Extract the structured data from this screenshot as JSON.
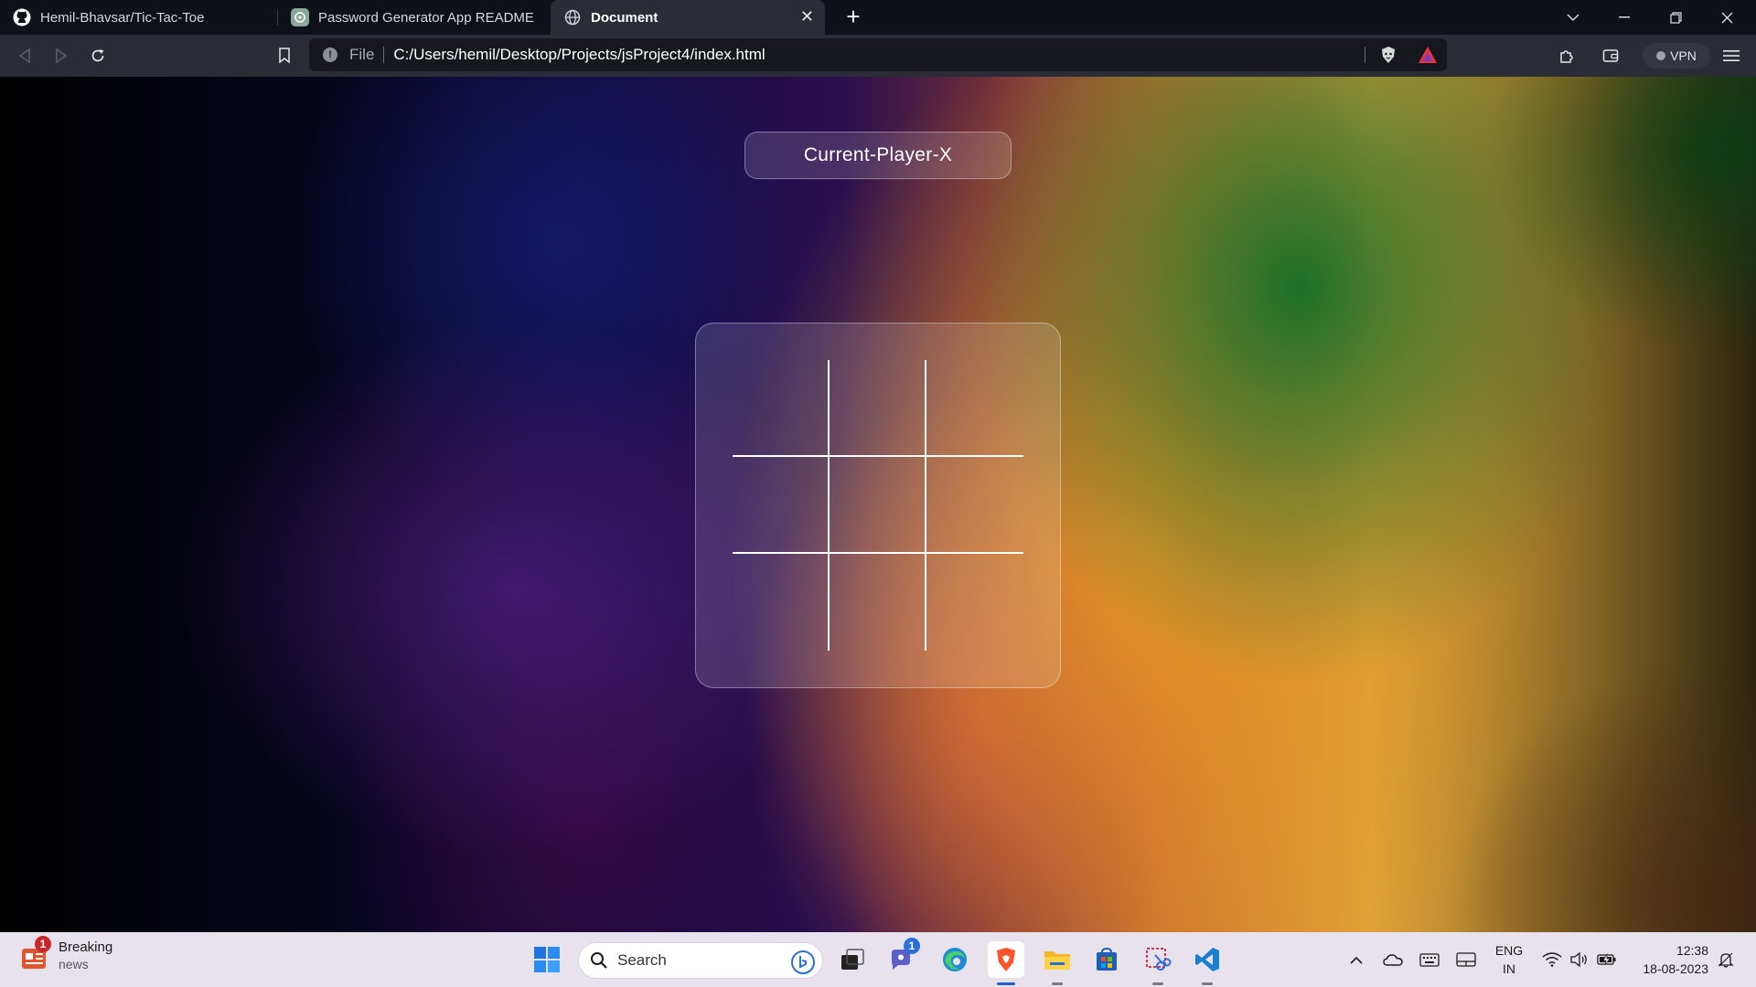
{
  "browser": {
    "tabs": [
      {
        "title": "Hemil-Bhavsar/Tic-Tac-Toe",
        "icon": "github-icon",
        "active": false
      },
      {
        "title": "Password Generator App README",
        "icon": "chatgpt-icon",
        "active": false
      },
      {
        "title": "Document",
        "icon": "globe-icon",
        "active": true
      }
    ],
    "new_tab": "+",
    "close_tab": "✕",
    "window_controls": {
      "dropdown": "⌵",
      "minimize": "—",
      "restore": "❐",
      "close": "✕"
    },
    "address": {
      "scheme_label": "File",
      "url": "C:/Users/hemil/Desktop/Projects/jsProject4/index.html"
    },
    "vpn_label": "VPN"
  },
  "page": {
    "current_player": "Current-Player-X",
    "board": [
      "",
      "",
      "",
      "",
      "",
      "",
      "",
      "",
      ""
    ]
  },
  "taskbar": {
    "news": {
      "title": "Breaking",
      "subtitle": "news",
      "badge": "1"
    },
    "search_label": "Search",
    "teams_badge": "1",
    "language": {
      "line1": "ENG",
      "line2": "IN"
    },
    "clock": {
      "time": "12:38",
      "date": "18-08-2023"
    },
    "accent": "#1a5fd6"
  }
}
